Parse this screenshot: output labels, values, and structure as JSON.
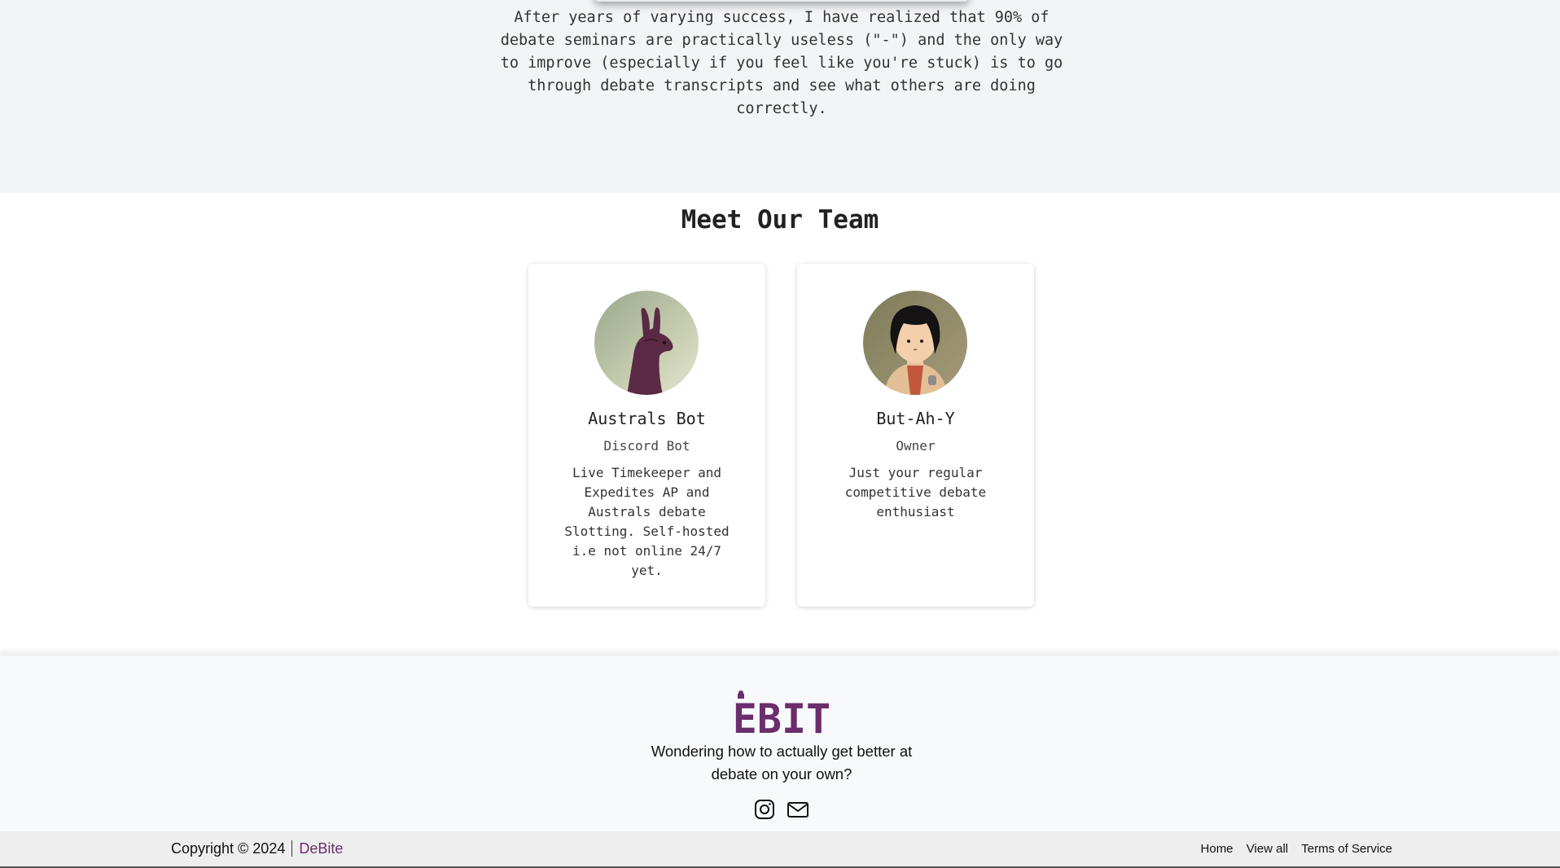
{
  "intro": {
    "text": "After years of varying success, I have realized that 90% of debate seminars are practically useless (\"-\") and the only way to improve (especially if you feel like you're stuck) is to go through debate transcripts and see what others are doing correctly."
  },
  "team": {
    "title": "Meet Our Team",
    "members": [
      {
        "name": "Australs Bot",
        "role": "Discord Bot",
        "description": "Live Timekeeper and Expedites AP and Australs debate Slotting. Self-hosted i.e not online 24/7 yet.",
        "avatar_icon": "kangaroo-avatar"
      },
      {
        "name": "But-Ah-Y",
        "role": "Owner",
        "description": "Just your regular competitive debate enthusiast",
        "avatar_icon": "girl-avatar"
      }
    ]
  },
  "footer": {
    "logo_text": "DEBITE",
    "tagline": "Wondering how to actually get better at debate on your own?",
    "social": [
      "instagram-icon",
      "mail-icon"
    ],
    "copyright": "Copyright © 2024",
    "brand": "DeBite",
    "nav": [
      "Home",
      "View all",
      "Terms of Service"
    ]
  },
  "colors": {
    "brand": "#6b2d6b",
    "intro_bg": "#f3f4f6",
    "footer_bg": "#f8f9fb",
    "bottom_bar_bg": "#eeeeee"
  }
}
